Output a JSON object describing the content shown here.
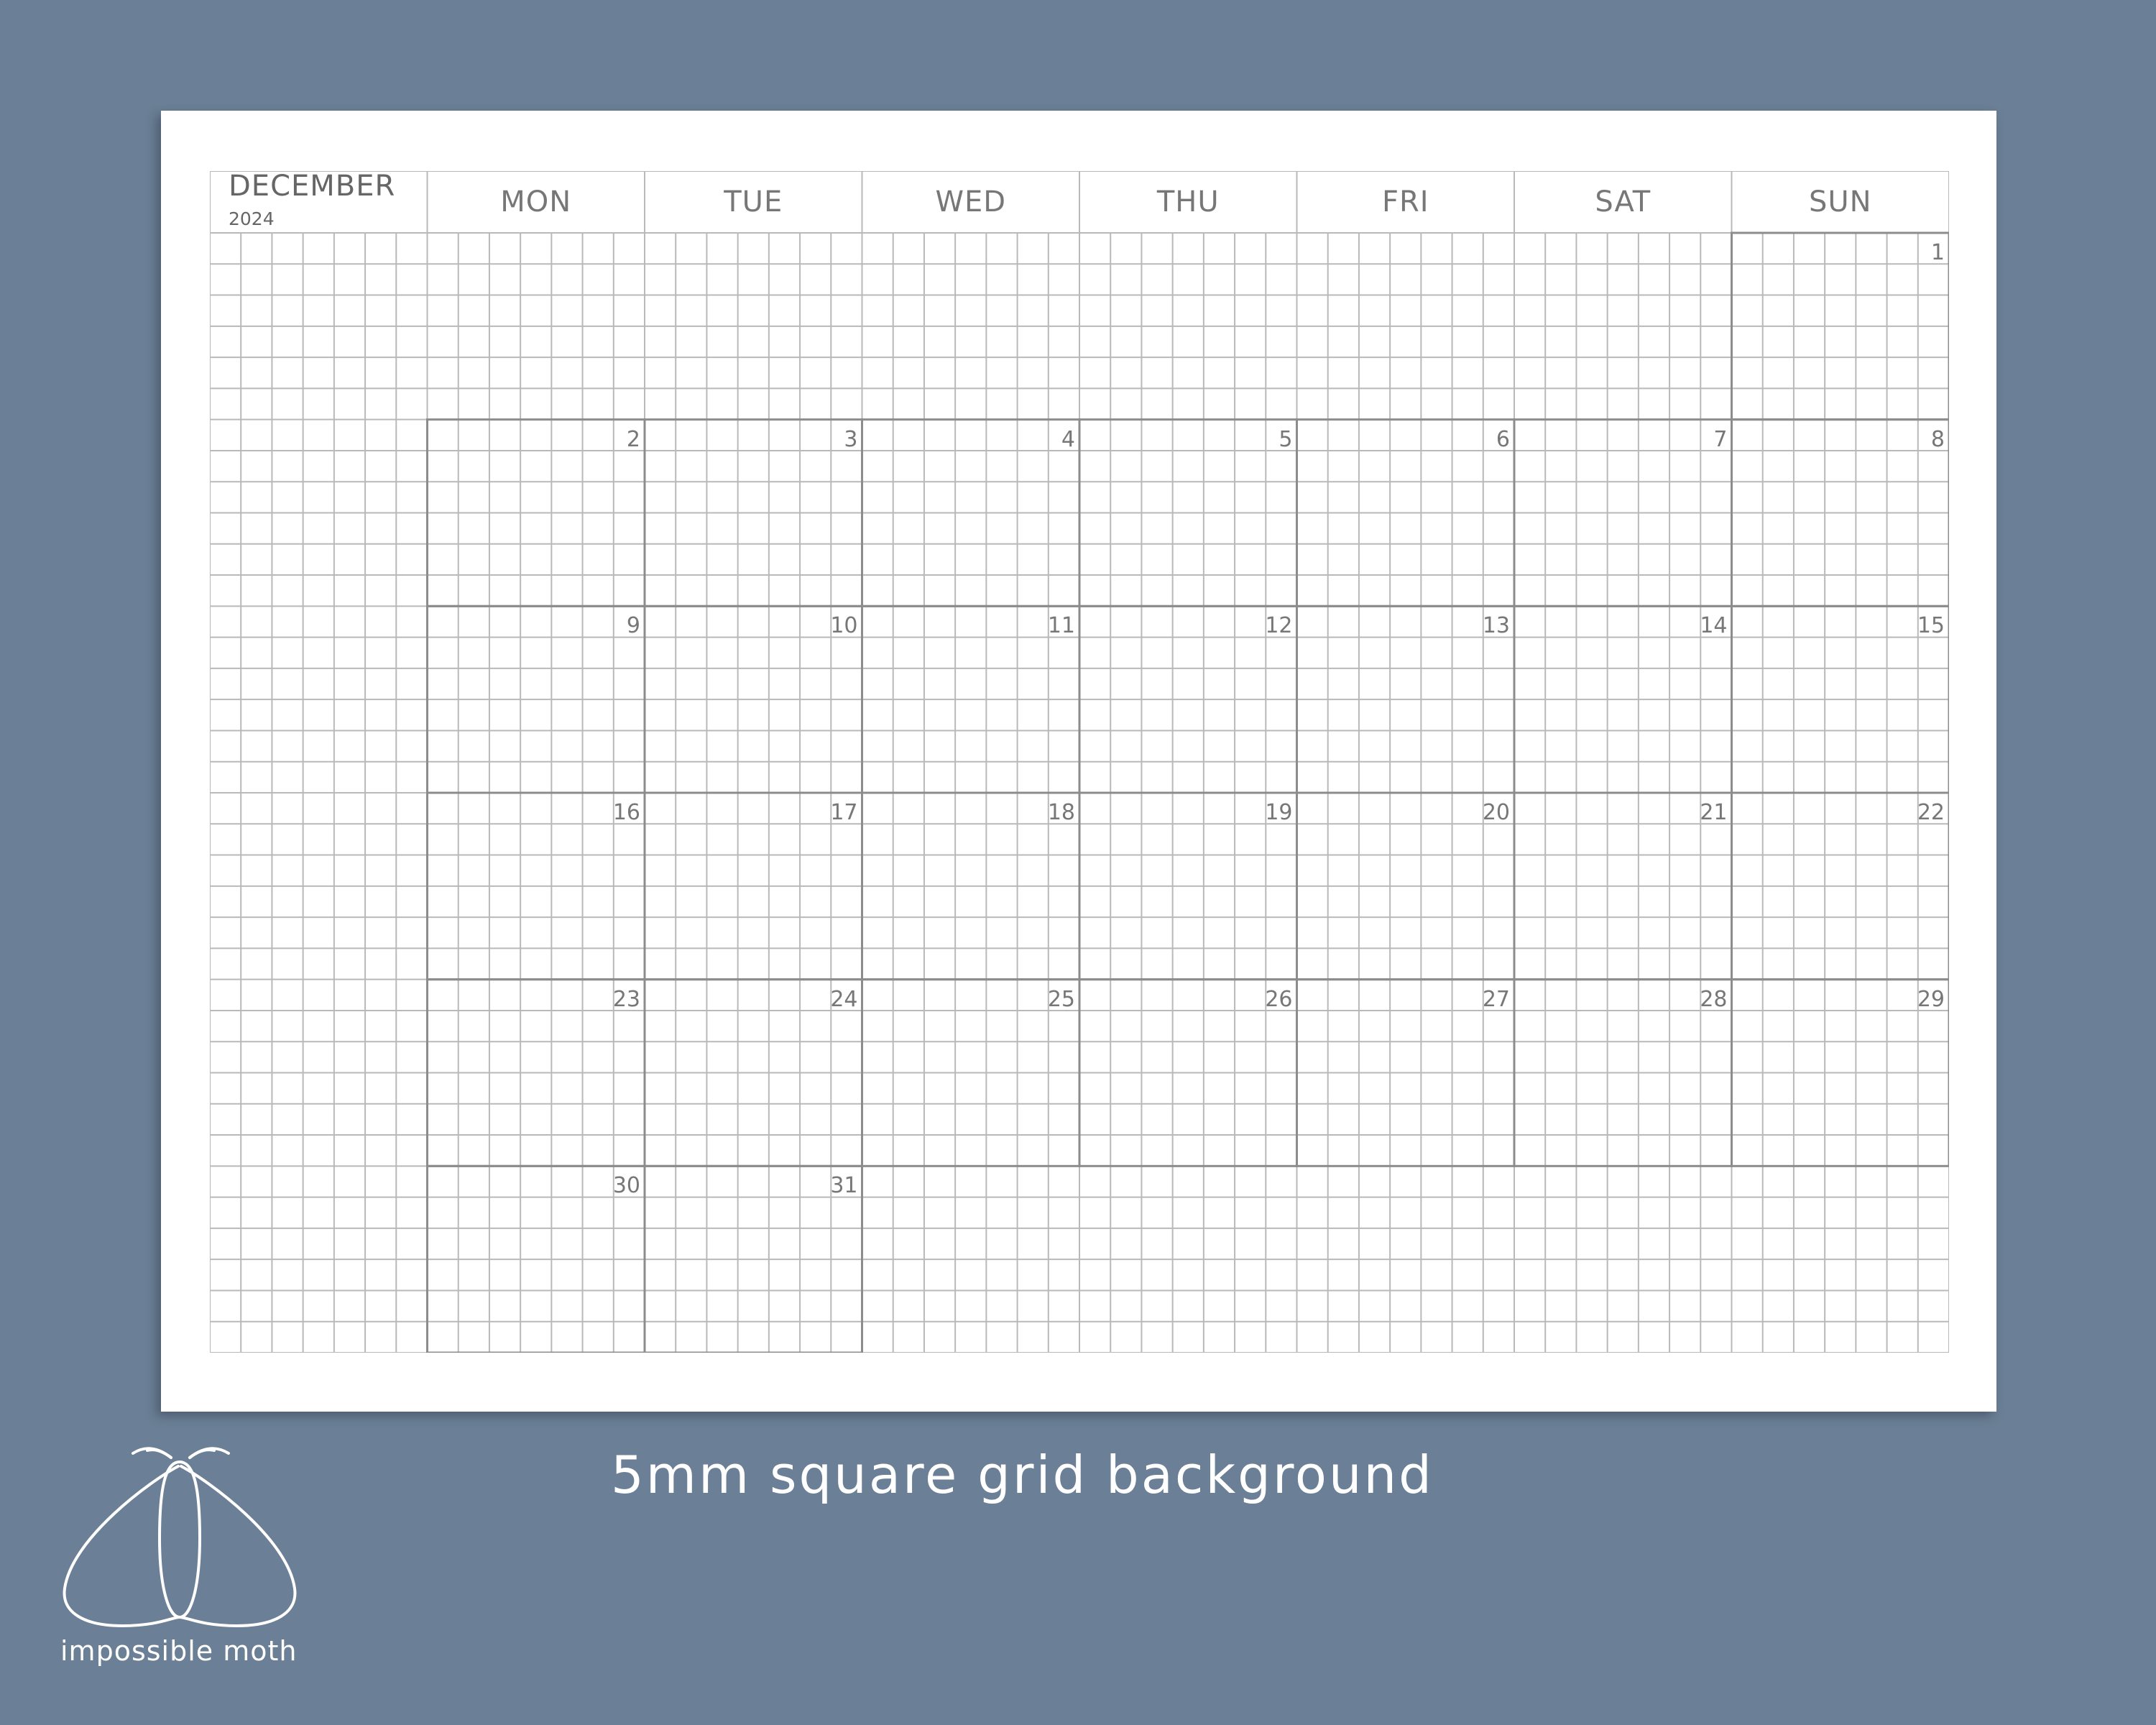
{
  "calendar": {
    "month": "DECEMBER",
    "year": "2024",
    "weekdays": [
      "MON",
      "TUE",
      "WED",
      "THU",
      "FRI",
      "SAT",
      "SUN"
    ],
    "start_weekday_index": 6,
    "days_in_month": 31
  },
  "caption": "5mm square grid background",
  "brand": {
    "name": "impossible moth",
    "logo": "moth-logo-icon"
  },
  "colors": {
    "background": "#6b7f96",
    "paper": "#ffffff",
    "grid_line": "#b9b9b9",
    "cell_border": "#8c8c8c",
    "text": "#777777"
  }
}
